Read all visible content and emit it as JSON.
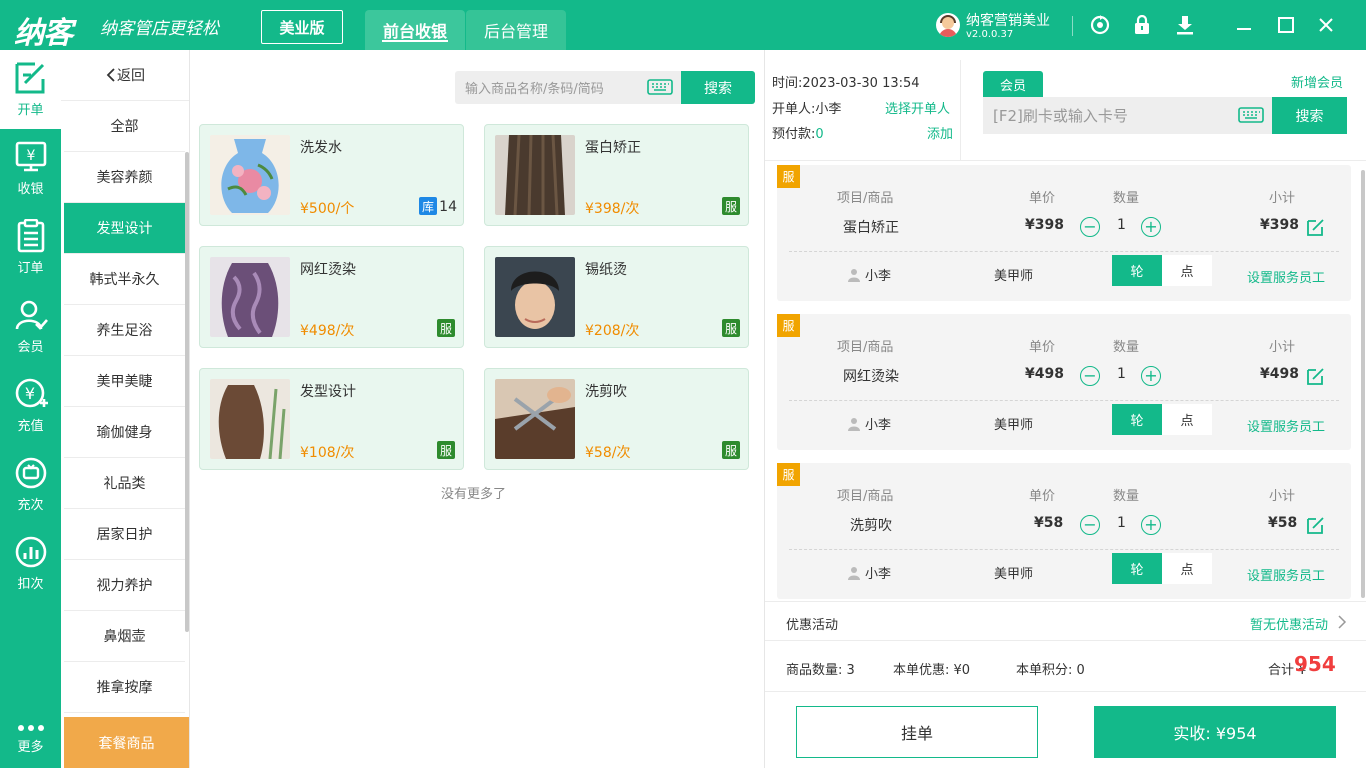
{
  "app": {
    "logo": "纳客",
    "slogan": "纳客管店更轻松",
    "edition": "美业版",
    "tabs": [
      "前台收银",
      "后台管理"
    ],
    "user": "纳客营销美业",
    "version": "v2.0.0.37",
    "accent": "#13b98a"
  },
  "nav": [
    {
      "label": "开单",
      "icon": "edit-icon"
    },
    {
      "label": "收银",
      "icon": "cashier-icon"
    },
    {
      "label": "订单",
      "icon": "order-icon"
    },
    {
      "label": "会员",
      "icon": "member-icon"
    },
    {
      "label": "充值",
      "icon": "recharge-icon"
    },
    {
      "label": "充次",
      "icon": "recharge-times-icon"
    },
    {
      "label": "扣次",
      "icon": "deduct-icon"
    },
    {
      "label": "更多",
      "icon": "more-icon"
    }
  ],
  "categories": {
    "back": "返回",
    "items": [
      "全部",
      "美容养颜",
      "发型设计",
      "韩式半永久",
      "养生足浴",
      "美甲美睫",
      "瑜伽健身",
      "礼品类",
      "居家日护",
      "视力养护",
      "鼻烟壶",
      "推拿按摩"
    ],
    "package": "套餐商品"
  },
  "products": {
    "search_placeholder": "输入商品名称/条码/简码",
    "search_button": "搜索",
    "items": [
      {
        "name": "洗发水",
        "price": "¥500/个",
        "stock_tag": "库",
        "stock": "14"
      },
      {
        "name": "蛋白矫正",
        "price": "¥398/次",
        "tag": "服"
      },
      {
        "name": "网红烫染",
        "price": "¥498/次",
        "tag": "服"
      },
      {
        "name": "锡纸烫",
        "price": "¥208/次",
        "tag": "服"
      },
      {
        "name": "发型设计",
        "price": "¥108/次",
        "tag": "服"
      },
      {
        "name": "洗剪吹",
        "price": "¥58/次",
        "tag": "服"
      }
    ],
    "no_more": "没有更多了"
  },
  "order": {
    "time_label": "时间:",
    "time": "2023-03-30 13:54",
    "opener_label": "开单人:",
    "opener": "小李",
    "choose_opener": "选择开单人",
    "prepaid_label": "预付款:",
    "prepaid": "0",
    "add": "添加",
    "member_tab": "会员",
    "new_member": "新增会员",
    "card_placeholder": "[F2]刷卡或输入卡号",
    "card_search": "搜索",
    "headers": {
      "item": "项目/商品",
      "price": "单价",
      "qty": "数量",
      "subtotal": "小计"
    },
    "lines": [
      {
        "badge": "服",
        "name": "蛋白矫正",
        "price": "¥398",
        "qty": "1",
        "subtotal": "¥398",
        "staff": "小李",
        "role": "美甲师",
        "rot": "轮",
        "pt": "点",
        "set_staff": "设置服务员工"
      },
      {
        "badge": "服",
        "name": "网红烫染",
        "price": "¥498",
        "qty": "1",
        "subtotal": "¥498",
        "staff": "小李",
        "role": "美甲师",
        "rot": "轮",
        "pt": "点",
        "set_staff": "设置服务员工"
      },
      {
        "badge": "服",
        "name": "洗剪吹",
        "price": "¥58",
        "qty": "1",
        "subtotal": "¥58",
        "staff": "小李",
        "role": "美甲师",
        "rot": "轮",
        "pt": "点",
        "set_staff": "设置服务员工"
      }
    ],
    "promo_label": "优惠活动",
    "promo_value": "暂无优惠活动",
    "count_label": "商品数量:",
    "count": "3",
    "discount_label": "本单优惠:",
    "discount": "¥0",
    "points_label": "本单积分:",
    "points": "0",
    "total_label": "合计 ¥",
    "total": "954",
    "hang": "挂单",
    "pay": "实收: ¥954"
  }
}
